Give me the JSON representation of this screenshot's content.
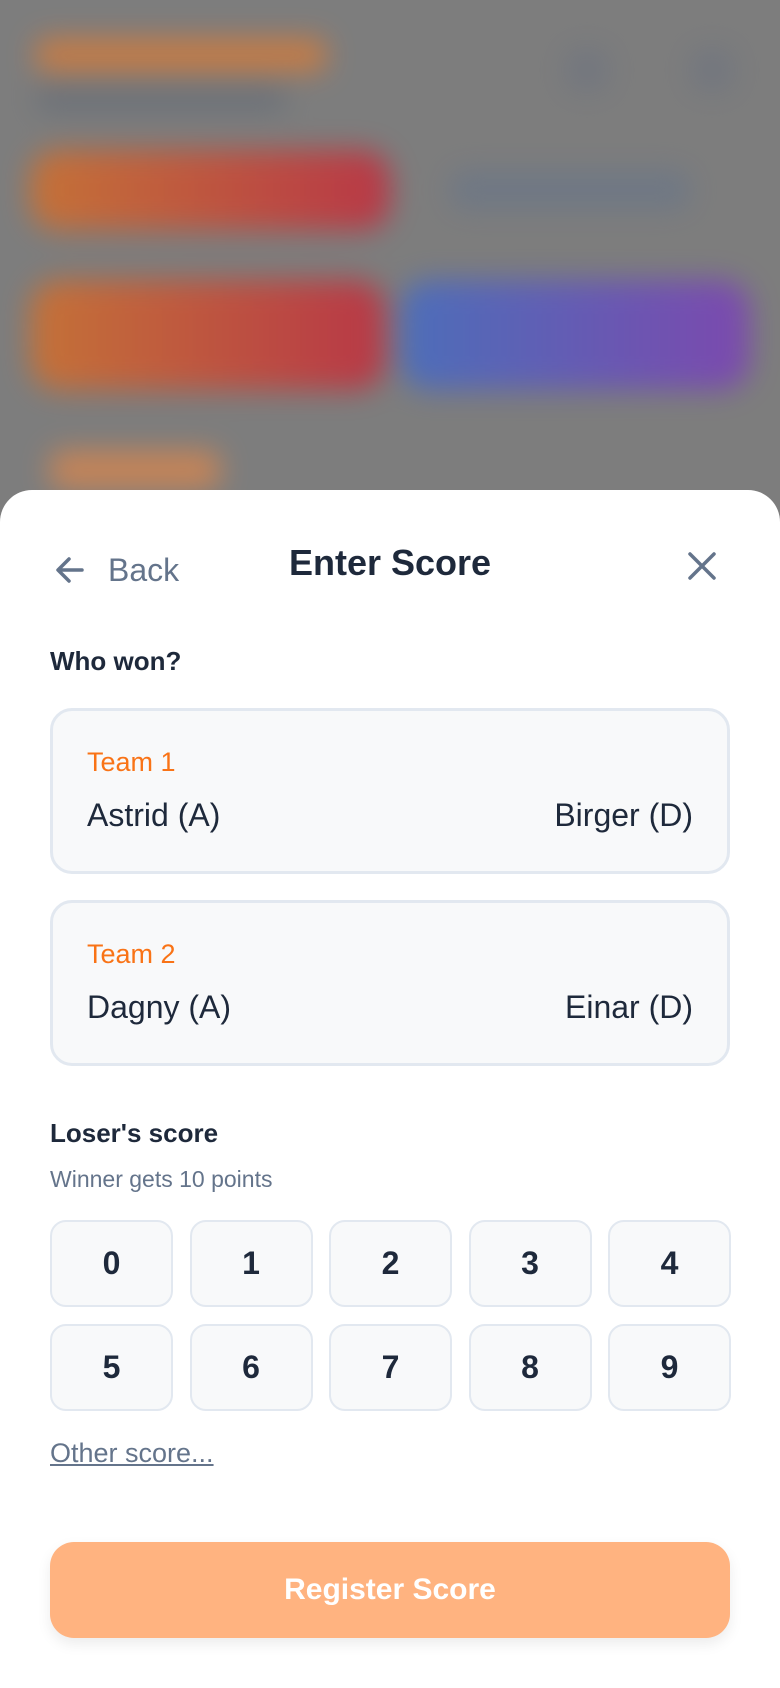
{
  "header": {
    "back_label": "Back",
    "title": "Enter Score"
  },
  "winner_section": {
    "label": "Who won?",
    "teams": [
      {
        "name": "Team 1",
        "player_a": "Astrid (A)",
        "player_d": "Birger (D)"
      },
      {
        "name": "Team 2",
        "player_a": "Dagny (A)",
        "player_d": "Einar (D)"
      }
    ]
  },
  "score_section": {
    "label": "Loser's score",
    "hint": "Winner gets 10 points",
    "options": [
      "0",
      "1",
      "2",
      "3",
      "4",
      "5",
      "6",
      "7",
      "8",
      "9"
    ],
    "other_label": "Other score..."
  },
  "register_label": "Register Score",
  "colors": {
    "accent": "#f97316",
    "register_button": "#ffb380",
    "text_primary": "#1e293b",
    "text_secondary": "#64748b"
  },
  "icons": {
    "back": "arrow-left-icon",
    "close": "close-icon"
  }
}
